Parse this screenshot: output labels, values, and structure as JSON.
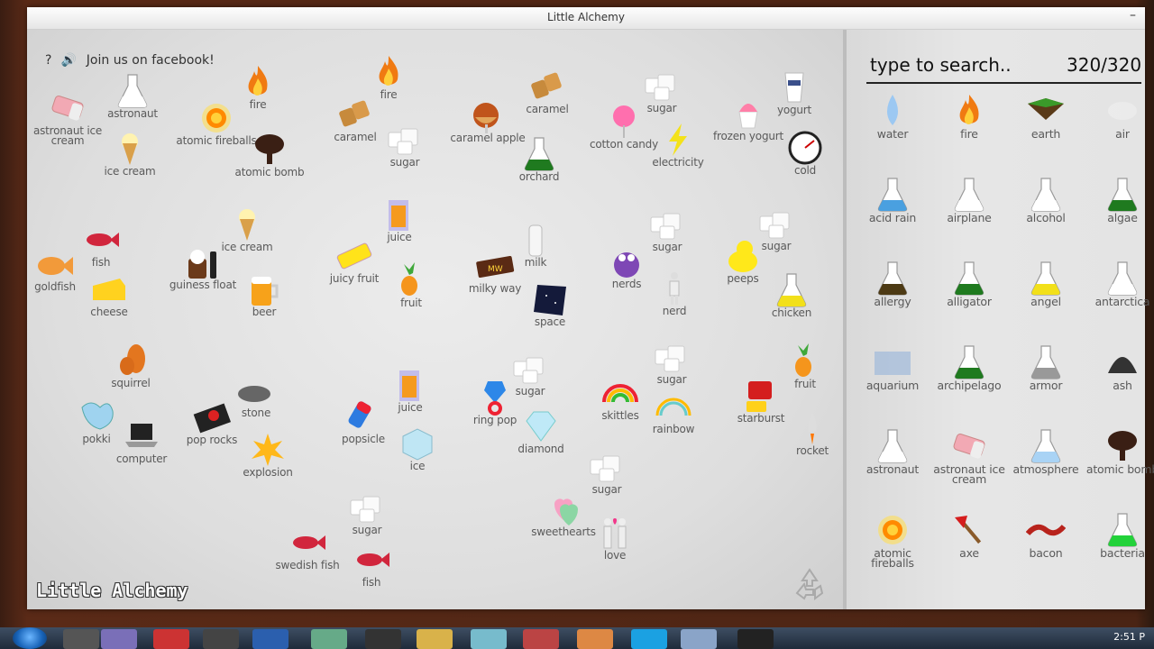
{
  "window": {
    "title": "Little Alchemy",
    "minimize": "–"
  },
  "board": {
    "help_icon": "?",
    "facebook_text": "Join us on facebook!",
    "logo": "Little Alchemy",
    "elements": [
      {
        "label": "astronaut ice cream",
        "icon": "eraser"
      },
      {
        "label": "astronaut",
        "icon": "flask-white"
      },
      {
        "label": "fire",
        "icon": "fire"
      },
      {
        "label": "atomic fireballs",
        "icon": "sun"
      },
      {
        "label": "atomic bomb",
        "icon": "tree-dark"
      },
      {
        "label": "fire",
        "icon": "fire"
      },
      {
        "label": "caramel",
        "icon": "caramel"
      },
      {
        "label": "sugar",
        "icon": "cubes"
      },
      {
        "label": "ice cream",
        "icon": "cone"
      },
      {
        "label": "caramel apple",
        "icon": "apple"
      },
      {
        "label": "caramel",
        "icon": "caramel"
      },
      {
        "label": "orchard",
        "icon": "flask-green"
      },
      {
        "label": "sugar",
        "icon": "cubes"
      },
      {
        "label": "cotton candy",
        "icon": "cotton"
      },
      {
        "label": "electricity",
        "icon": "bolt"
      },
      {
        "label": "frozen yogurt",
        "icon": "froyo"
      },
      {
        "label": "yogurt",
        "icon": "cup"
      },
      {
        "label": "cold",
        "icon": "gauge"
      },
      {
        "label": "fish",
        "icon": "fish-red"
      },
      {
        "label": "goldfish",
        "icon": "goldfish"
      },
      {
        "label": "cheese",
        "icon": "cheese"
      },
      {
        "label": "guiness float",
        "icon": "float"
      },
      {
        "label": "ice cream",
        "icon": "cone"
      },
      {
        "label": "beer",
        "icon": "beer"
      },
      {
        "label": "juice",
        "icon": "juice"
      },
      {
        "label": "juicy fruit",
        "icon": "gum"
      },
      {
        "label": "fruit",
        "icon": "pineapple"
      },
      {
        "label": "milk",
        "icon": "milk"
      },
      {
        "label": "milky way",
        "icon": "candybar"
      },
      {
        "label": "space",
        "icon": "space"
      },
      {
        "label": "sugar",
        "icon": "cubes"
      },
      {
        "label": "nerds",
        "icon": "nerds"
      },
      {
        "label": "nerd",
        "icon": "person"
      },
      {
        "label": "sugar",
        "icon": "cubes"
      },
      {
        "label": "peeps",
        "icon": "peeps"
      },
      {
        "label": "chicken",
        "icon": "flask-yellow"
      },
      {
        "label": "squirrel",
        "icon": "squirrel"
      },
      {
        "label": "pokki",
        "icon": "pokki"
      },
      {
        "label": "computer",
        "icon": "laptop"
      },
      {
        "label": "pop rocks",
        "icon": "poprocks"
      },
      {
        "label": "stone",
        "icon": "stone"
      },
      {
        "label": "explosion",
        "icon": "explosion"
      },
      {
        "label": "juice",
        "icon": "juice"
      },
      {
        "label": "popsicle",
        "icon": "popsicle"
      },
      {
        "label": "ice",
        "icon": "icecube"
      },
      {
        "label": "sugar",
        "icon": "cubes"
      },
      {
        "label": "ring pop",
        "icon": "ringpop"
      },
      {
        "label": "diamond",
        "icon": "diamond"
      },
      {
        "label": "sugar",
        "icon": "cubes"
      },
      {
        "label": "skittles",
        "icon": "skittles"
      },
      {
        "label": "rainbow",
        "icon": "rainbow"
      },
      {
        "label": "fruit",
        "icon": "pineapple"
      },
      {
        "label": "starburst",
        "icon": "starburst"
      },
      {
        "label": "rocket",
        "icon": "rocket"
      },
      {
        "label": "sugar",
        "icon": "cubes"
      },
      {
        "label": "sweethearts",
        "icon": "hearts"
      },
      {
        "label": "love",
        "icon": "couple"
      },
      {
        "label": "sugar",
        "icon": "cubes"
      },
      {
        "label": "swedish fish",
        "icon": "fish-red"
      },
      {
        "label": "fish",
        "icon": "fish-red"
      }
    ]
  },
  "library": {
    "search_placeholder": "type to search..",
    "count": "320/320",
    "items": [
      {
        "label": "water",
        "icon": "drop"
      },
      {
        "label": "fire",
        "icon": "fire"
      },
      {
        "label": "earth",
        "icon": "earth"
      },
      {
        "label": "air",
        "icon": "air"
      },
      {
        "label": "acid rain",
        "icon": "flask-blue"
      },
      {
        "label": "airplane",
        "icon": "flask-white"
      },
      {
        "label": "alcohol",
        "icon": "flask-white"
      },
      {
        "label": "algae",
        "icon": "flask-green"
      },
      {
        "label": "allergy",
        "icon": "flask-brown"
      },
      {
        "label": "alligator",
        "icon": "flask-green"
      },
      {
        "label": "angel",
        "icon": "flask-yellow"
      },
      {
        "label": "antarctica",
        "icon": "flask-white"
      },
      {
        "label": "aquarium",
        "icon": "tank"
      },
      {
        "label": "archipelago",
        "icon": "flask-green"
      },
      {
        "label": "armor",
        "icon": "flask-grey"
      },
      {
        "label": "ash",
        "icon": "ash"
      },
      {
        "label": "astronaut",
        "icon": "flask-white"
      },
      {
        "label": "astronaut ice cream",
        "icon": "eraser"
      },
      {
        "label": "atmosphere",
        "icon": "flask-lightblue"
      },
      {
        "label": "atomic bomb",
        "icon": "tree-dark"
      },
      {
        "label": "atomic fireballs",
        "icon": "sun"
      },
      {
        "label": "axe",
        "icon": "axe"
      },
      {
        "label": "bacon",
        "icon": "bacon"
      },
      {
        "label": "bacteria",
        "icon": "flask-brightgreen"
      }
    ]
  },
  "taskbar": {
    "clock": "2:51 P"
  },
  "colors": {
    "board": "#e3e3e3",
    "panel": "#e2e2e2",
    "text": "#5a5a5a"
  }
}
